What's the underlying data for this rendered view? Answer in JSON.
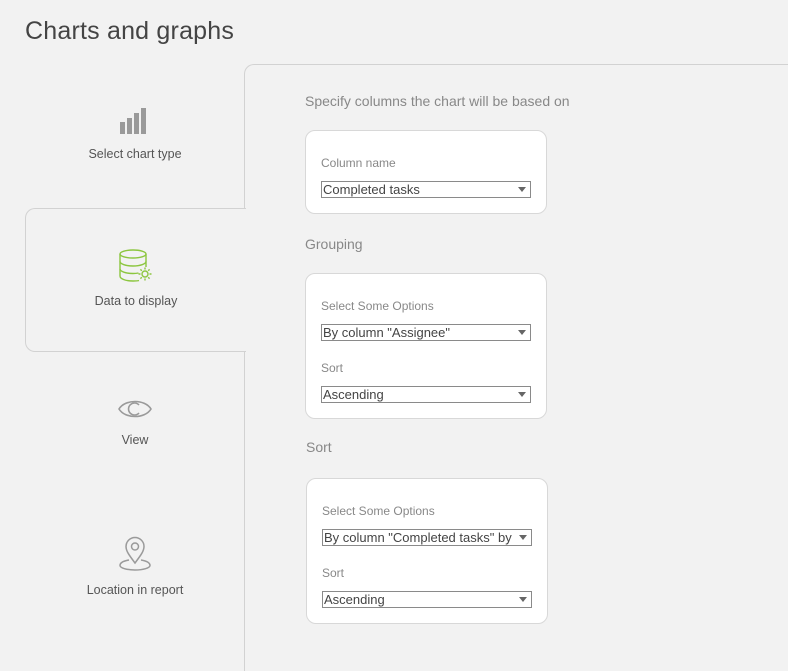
{
  "page": {
    "title": "Charts and graphs"
  },
  "steps": [
    {
      "label": "Select chart type",
      "icon": "bar-chart-icon"
    },
    {
      "label": "Data to display",
      "icon": "database-settings-icon"
    },
    {
      "label": "View",
      "icon": "eye-icon"
    },
    {
      "label": "Location in report",
      "icon": "map-pin-icon"
    }
  ],
  "colors": {
    "accent": "#8cc63f",
    "icon_gray": "#9a9a9a"
  },
  "columns": {
    "title": "Specify columns the chart will be based on",
    "column_name_label": "Column name",
    "column_name_value": "Completed tasks"
  },
  "grouping": {
    "title": "Grouping",
    "options_label": "Select Some Options",
    "options_value": "By column \"Assignee\"",
    "sort_label": "Sort",
    "sort_value": "Ascending"
  },
  "sort": {
    "title": "Sort",
    "options_label": "Select Some Options",
    "options_value": "By column \"Completed tasks\" by",
    "sort_label": "Sort",
    "sort_value": "Ascending"
  }
}
